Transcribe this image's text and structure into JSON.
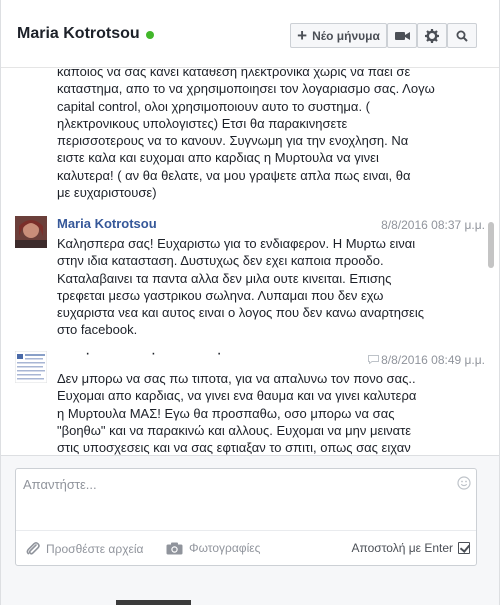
{
  "header": {
    "title": "Maria Kotrotsou",
    "new_message_label": "Νέο μήνυμα",
    "status_color": "#42b72a",
    "icons": [
      "plus-icon",
      "video-camera-icon",
      "gear-icon",
      "search-icon"
    ]
  },
  "messages": [
    {
      "text": "κάποιος να σας κάνει κατάθεση ηλεκτρονικά χωρίς να πάει σε\nκαταστημα, απο το να χρησιμοποιησει τον λογαριασμο σας. Λογω\ncapital control, ολοι χρησιμοποιουν αυτο το συστημα. (\nηλεκτρονικους υπολογιστες) Ετσι θα παρακινησετε\nπερισσοτερους να το κανουν. Συγνωμη για την ενοχληση. Να\nειστε καλα και ευχομαι απο καρδιας η Μυρτουλα να γινει\nκαλυτερα! ( αν θα θελατε, να μου γραψετε απλα πως ειναι, θα\nμε ευχαριστουσε)"
    },
    {
      "sender": "Maria Kotrotsou",
      "timestamp": "8/8/2016 08:37 μ.μ.",
      "text": "Καλησπερα σας! Ευχαριστω για το ενδιαφερον. Η Μυρτω ειναι\nστην ιδια κατασταση. Δυστυχως δεν εχει καποια προοδο.\nΚαταλαβαινει τα παντα αλλα δεν μιλα ουτε κινειται. Επισης\nτρεφεται μεσω γαστρικου σωληνα. Λυπαμαι που δεν εχω\nευχαριστα νεα και αυτος ειναι ο λογος που δεν κανω αναρτησεις\nστο facebook."
    },
    {
      "sender_dots": "· · ·",
      "timestamp": "8/8/2016 08:49 μ.μ.",
      "text": "Δεν μπορω να σας πω τιποτα, για να απαλυνω τον πονο σας..\nΕυχομαι απο καρδιας, να γινει ενα θαυμα και να γινει καλυτερα\nη Μυρτουλα ΜΑΣ! Εγω θα προσπαθω, οσο μπορω να σας\n\"βοηθω\" και να παρακινώ και αλλους. Ευχομαι να μην μεινατε\nστις υποσχεσεις και να σας εφτιαξαν το σπιτι, οπως σας ειχαν"
    }
  ],
  "composer": {
    "placeholder": "Απαντήστε...",
    "add_files_label": "Προσθέστε αρχεία",
    "photos_label": "Φωτογραφίες",
    "send_on_enter_label": "Αποστολή με Enter",
    "send_on_enter_checked": true
  }
}
